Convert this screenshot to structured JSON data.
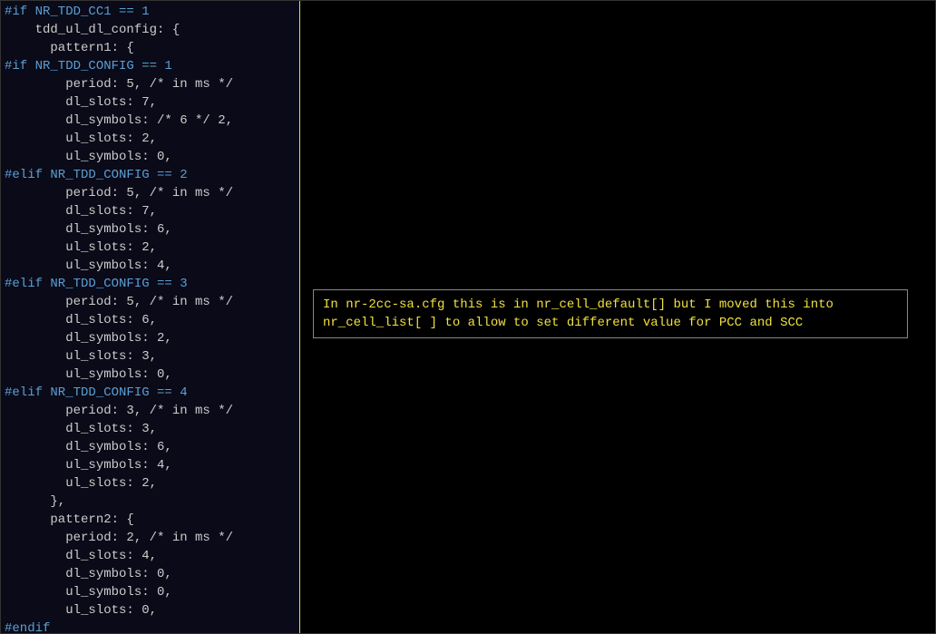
{
  "code": {
    "lines": [
      {
        "type": "directive",
        "text": "#if NR_TDD_CC1 == 1"
      },
      {
        "type": "normal",
        "text": "    tdd_ul_dl_config: {"
      },
      {
        "type": "normal",
        "text": "      pattern1: {"
      },
      {
        "type": "directive",
        "text": "#if NR_TDD_CONFIG == 1"
      },
      {
        "type": "normal",
        "text": "        period: 5, /* in ms */"
      },
      {
        "type": "normal",
        "text": "        dl_slots: 7,"
      },
      {
        "type": "normal",
        "text": "        dl_symbols: /* 6 */ 2,"
      },
      {
        "type": "normal",
        "text": "        ul_slots: 2,"
      },
      {
        "type": "normal",
        "text": "        ul_symbols: 0,"
      },
      {
        "type": "directive",
        "text": "#elif NR_TDD_CONFIG == 2"
      },
      {
        "type": "normal",
        "text": "        period: 5, /* in ms */"
      },
      {
        "type": "normal",
        "text": "        dl_slots: 7,"
      },
      {
        "type": "normal",
        "text": "        dl_symbols: 6,"
      },
      {
        "type": "normal",
        "text": "        ul_slots: 2,"
      },
      {
        "type": "normal",
        "text": "        ul_symbols: 4,"
      },
      {
        "type": "directive",
        "text": "#elif NR_TDD_CONFIG == 3"
      },
      {
        "type": "normal",
        "text": "        period: 5, /* in ms */"
      },
      {
        "type": "normal",
        "text": "        dl_slots: 6,"
      },
      {
        "type": "normal",
        "text": "        dl_symbols: 2,"
      },
      {
        "type": "normal",
        "text": "        ul_slots: 3,"
      },
      {
        "type": "normal",
        "text": "        ul_symbols: 0,"
      },
      {
        "type": "directive",
        "text": "#elif NR_TDD_CONFIG == 4"
      },
      {
        "type": "normal",
        "text": "        period: 3, /* in ms */"
      },
      {
        "type": "normal",
        "text": "        dl_slots: 3,"
      },
      {
        "type": "normal",
        "text": "        dl_symbols: 6,"
      },
      {
        "type": "normal",
        "text": "        ul_symbols: 4,"
      },
      {
        "type": "normal",
        "text": "        ul_slots: 2,"
      },
      {
        "type": "normal",
        "text": "      },"
      },
      {
        "type": "normal",
        "text": "      pattern2: {"
      },
      {
        "type": "normal",
        "text": "        period: 2, /* in ms */"
      },
      {
        "type": "normal",
        "text": "        dl_slots: 4,"
      },
      {
        "type": "normal",
        "text": "        dl_symbols: 0,"
      },
      {
        "type": "normal",
        "text": "        ul_symbols: 0,"
      },
      {
        "type": "normal",
        "text": "        ul_slots: 0,"
      },
      {
        "type": "directive",
        "text": "#endif"
      }
    ]
  },
  "annotation": {
    "text": "In nr-2cc-sa.cfg this is in nr_cell_default[] but I moved this into nr_cell_list[ ] to allow to set different value for PCC and SCC"
  }
}
